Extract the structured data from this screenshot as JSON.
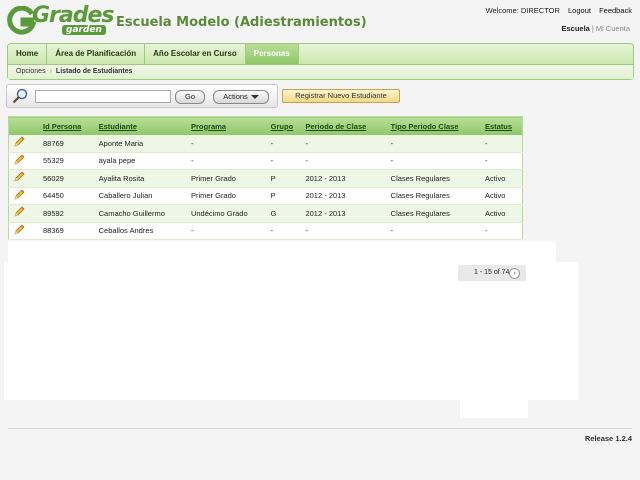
{
  "header": {
    "logo_text": "Grades",
    "logo_sub": "garden",
    "school_name": "Escuela Modelo (Adiestramientos)",
    "welcome": "Welcome: DIRECTOR",
    "logout": "Logout",
    "feedback": "Feedback",
    "school_link": "Escuela",
    "account_link": "Mi Cuenta"
  },
  "nav": {
    "tabs": [
      {
        "label": "Home"
      },
      {
        "label": "Área de Planificación"
      },
      {
        "label": "Año Escolar en Curso"
      },
      {
        "label": "Personas"
      }
    ],
    "active_tab": "Personas",
    "breadcrumb": {
      "parent": "Opciones",
      "current": "Listado de Estudiantes"
    }
  },
  "toolbar": {
    "search_value": "",
    "go_label": "Go",
    "actions_label": "Actions",
    "register_label": "Registrar Nuevo Estudiante"
  },
  "table": {
    "columns": [
      "Id Persona",
      "Estudiante",
      "Programa",
      "Grupo",
      "Periodo de Clase",
      "Tipo Periodo Clase",
      "Estatus"
    ],
    "rows": [
      {
        "id": "88769",
        "name": "Aponte Maria",
        "program": "-",
        "group": "-",
        "period": "-",
        "type": "-",
        "status": "-"
      },
      {
        "id": "55329",
        "name": "ayala pepe",
        "program": "-",
        "group": "-",
        "period": "-",
        "type": "-",
        "status": "-"
      },
      {
        "id": "56029",
        "name": "Ayalita Rosita",
        "program": "Primer Grado",
        "group": "P",
        "period": "2012 - 2013",
        "type": "Clases Regulares",
        "status": "Activo"
      },
      {
        "id": "64450",
        "name": "Caballero Julian",
        "program": "Primer Grado",
        "group": "P",
        "period": "2012 - 2013",
        "type": "Clases Regulares",
        "status": "Activo"
      },
      {
        "id": "89592",
        "name": "Camacho Guillermo",
        "program": "Undécimo Grado",
        "group": "G",
        "period": "2012 - 2013",
        "type": "Clases Regulares",
        "status": "Activo"
      },
      {
        "id": "88369",
        "name": "Ceballos Andres",
        "program": "-",
        "group": "-",
        "period": "-",
        "type": "-",
        "status": "-"
      }
    ]
  },
  "pager": {
    "text": "1 - 15 of 74",
    "next_symbol": "›"
  },
  "footer": {
    "release": "Release 1.2.4"
  },
  "colors": {
    "brand_green": "#5a9a3a",
    "tab_active": "#8fc76a",
    "register_button": "#f2d98a"
  }
}
